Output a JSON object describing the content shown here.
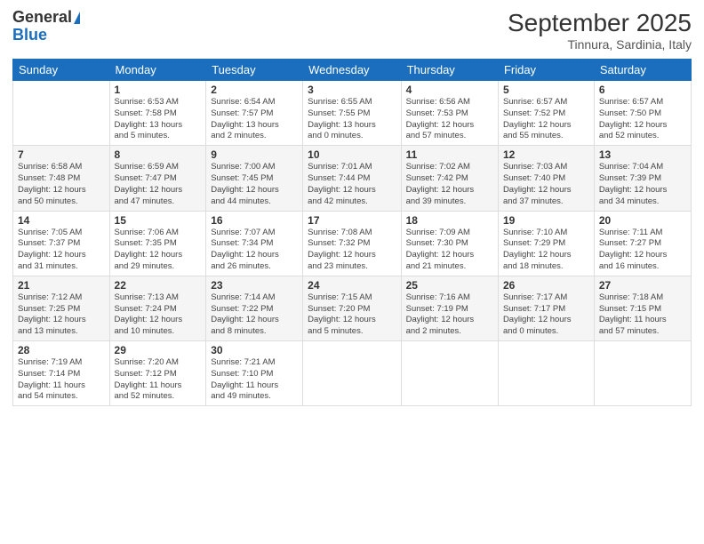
{
  "logo": {
    "general": "General",
    "blue": "Blue"
  },
  "title": "September 2025",
  "location": "Tinnura, Sardinia, Italy",
  "days_of_week": [
    "Sunday",
    "Monday",
    "Tuesday",
    "Wednesday",
    "Thursday",
    "Friday",
    "Saturday"
  ],
  "weeks": [
    [
      {
        "day": "",
        "info": ""
      },
      {
        "day": "1",
        "info": "Sunrise: 6:53 AM\nSunset: 7:58 PM\nDaylight: 13 hours\nand 5 minutes."
      },
      {
        "day": "2",
        "info": "Sunrise: 6:54 AM\nSunset: 7:57 PM\nDaylight: 13 hours\nand 2 minutes."
      },
      {
        "day": "3",
        "info": "Sunrise: 6:55 AM\nSunset: 7:55 PM\nDaylight: 13 hours\nand 0 minutes."
      },
      {
        "day": "4",
        "info": "Sunrise: 6:56 AM\nSunset: 7:53 PM\nDaylight: 12 hours\nand 57 minutes."
      },
      {
        "day": "5",
        "info": "Sunrise: 6:57 AM\nSunset: 7:52 PM\nDaylight: 12 hours\nand 55 minutes."
      },
      {
        "day": "6",
        "info": "Sunrise: 6:57 AM\nSunset: 7:50 PM\nDaylight: 12 hours\nand 52 minutes."
      }
    ],
    [
      {
        "day": "7",
        "info": "Sunrise: 6:58 AM\nSunset: 7:48 PM\nDaylight: 12 hours\nand 50 minutes."
      },
      {
        "day": "8",
        "info": "Sunrise: 6:59 AM\nSunset: 7:47 PM\nDaylight: 12 hours\nand 47 minutes."
      },
      {
        "day": "9",
        "info": "Sunrise: 7:00 AM\nSunset: 7:45 PM\nDaylight: 12 hours\nand 44 minutes."
      },
      {
        "day": "10",
        "info": "Sunrise: 7:01 AM\nSunset: 7:44 PM\nDaylight: 12 hours\nand 42 minutes."
      },
      {
        "day": "11",
        "info": "Sunrise: 7:02 AM\nSunset: 7:42 PM\nDaylight: 12 hours\nand 39 minutes."
      },
      {
        "day": "12",
        "info": "Sunrise: 7:03 AM\nSunset: 7:40 PM\nDaylight: 12 hours\nand 37 minutes."
      },
      {
        "day": "13",
        "info": "Sunrise: 7:04 AM\nSunset: 7:39 PM\nDaylight: 12 hours\nand 34 minutes."
      }
    ],
    [
      {
        "day": "14",
        "info": "Sunrise: 7:05 AM\nSunset: 7:37 PM\nDaylight: 12 hours\nand 31 minutes."
      },
      {
        "day": "15",
        "info": "Sunrise: 7:06 AM\nSunset: 7:35 PM\nDaylight: 12 hours\nand 29 minutes."
      },
      {
        "day": "16",
        "info": "Sunrise: 7:07 AM\nSunset: 7:34 PM\nDaylight: 12 hours\nand 26 minutes."
      },
      {
        "day": "17",
        "info": "Sunrise: 7:08 AM\nSunset: 7:32 PM\nDaylight: 12 hours\nand 23 minutes."
      },
      {
        "day": "18",
        "info": "Sunrise: 7:09 AM\nSunset: 7:30 PM\nDaylight: 12 hours\nand 21 minutes."
      },
      {
        "day": "19",
        "info": "Sunrise: 7:10 AM\nSunset: 7:29 PM\nDaylight: 12 hours\nand 18 minutes."
      },
      {
        "day": "20",
        "info": "Sunrise: 7:11 AM\nSunset: 7:27 PM\nDaylight: 12 hours\nand 16 minutes."
      }
    ],
    [
      {
        "day": "21",
        "info": "Sunrise: 7:12 AM\nSunset: 7:25 PM\nDaylight: 12 hours\nand 13 minutes."
      },
      {
        "day": "22",
        "info": "Sunrise: 7:13 AM\nSunset: 7:24 PM\nDaylight: 12 hours\nand 10 minutes."
      },
      {
        "day": "23",
        "info": "Sunrise: 7:14 AM\nSunset: 7:22 PM\nDaylight: 12 hours\nand 8 minutes."
      },
      {
        "day": "24",
        "info": "Sunrise: 7:15 AM\nSunset: 7:20 PM\nDaylight: 12 hours\nand 5 minutes."
      },
      {
        "day": "25",
        "info": "Sunrise: 7:16 AM\nSunset: 7:19 PM\nDaylight: 12 hours\nand 2 minutes."
      },
      {
        "day": "26",
        "info": "Sunrise: 7:17 AM\nSunset: 7:17 PM\nDaylight: 12 hours\nand 0 minutes."
      },
      {
        "day": "27",
        "info": "Sunrise: 7:18 AM\nSunset: 7:15 PM\nDaylight: 11 hours\nand 57 minutes."
      }
    ],
    [
      {
        "day": "28",
        "info": "Sunrise: 7:19 AM\nSunset: 7:14 PM\nDaylight: 11 hours\nand 54 minutes."
      },
      {
        "day": "29",
        "info": "Sunrise: 7:20 AM\nSunset: 7:12 PM\nDaylight: 11 hours\nand 52 minutes."
      },
      {
        "day": "30",
        "info": "Sunrise: 7:21 AM\nSunset: 7:10 PM\nDaylight: 11 hours\nand 49 minutes."
      },
      {
        "day": "",
        "info": ""
      },
      {
        "day": "",
        "info": ""
      },
      {
        "day": "",
        "info": ""
      },
      {
        "day": "",
        "info": ""
      }
    ]
  ]
}
